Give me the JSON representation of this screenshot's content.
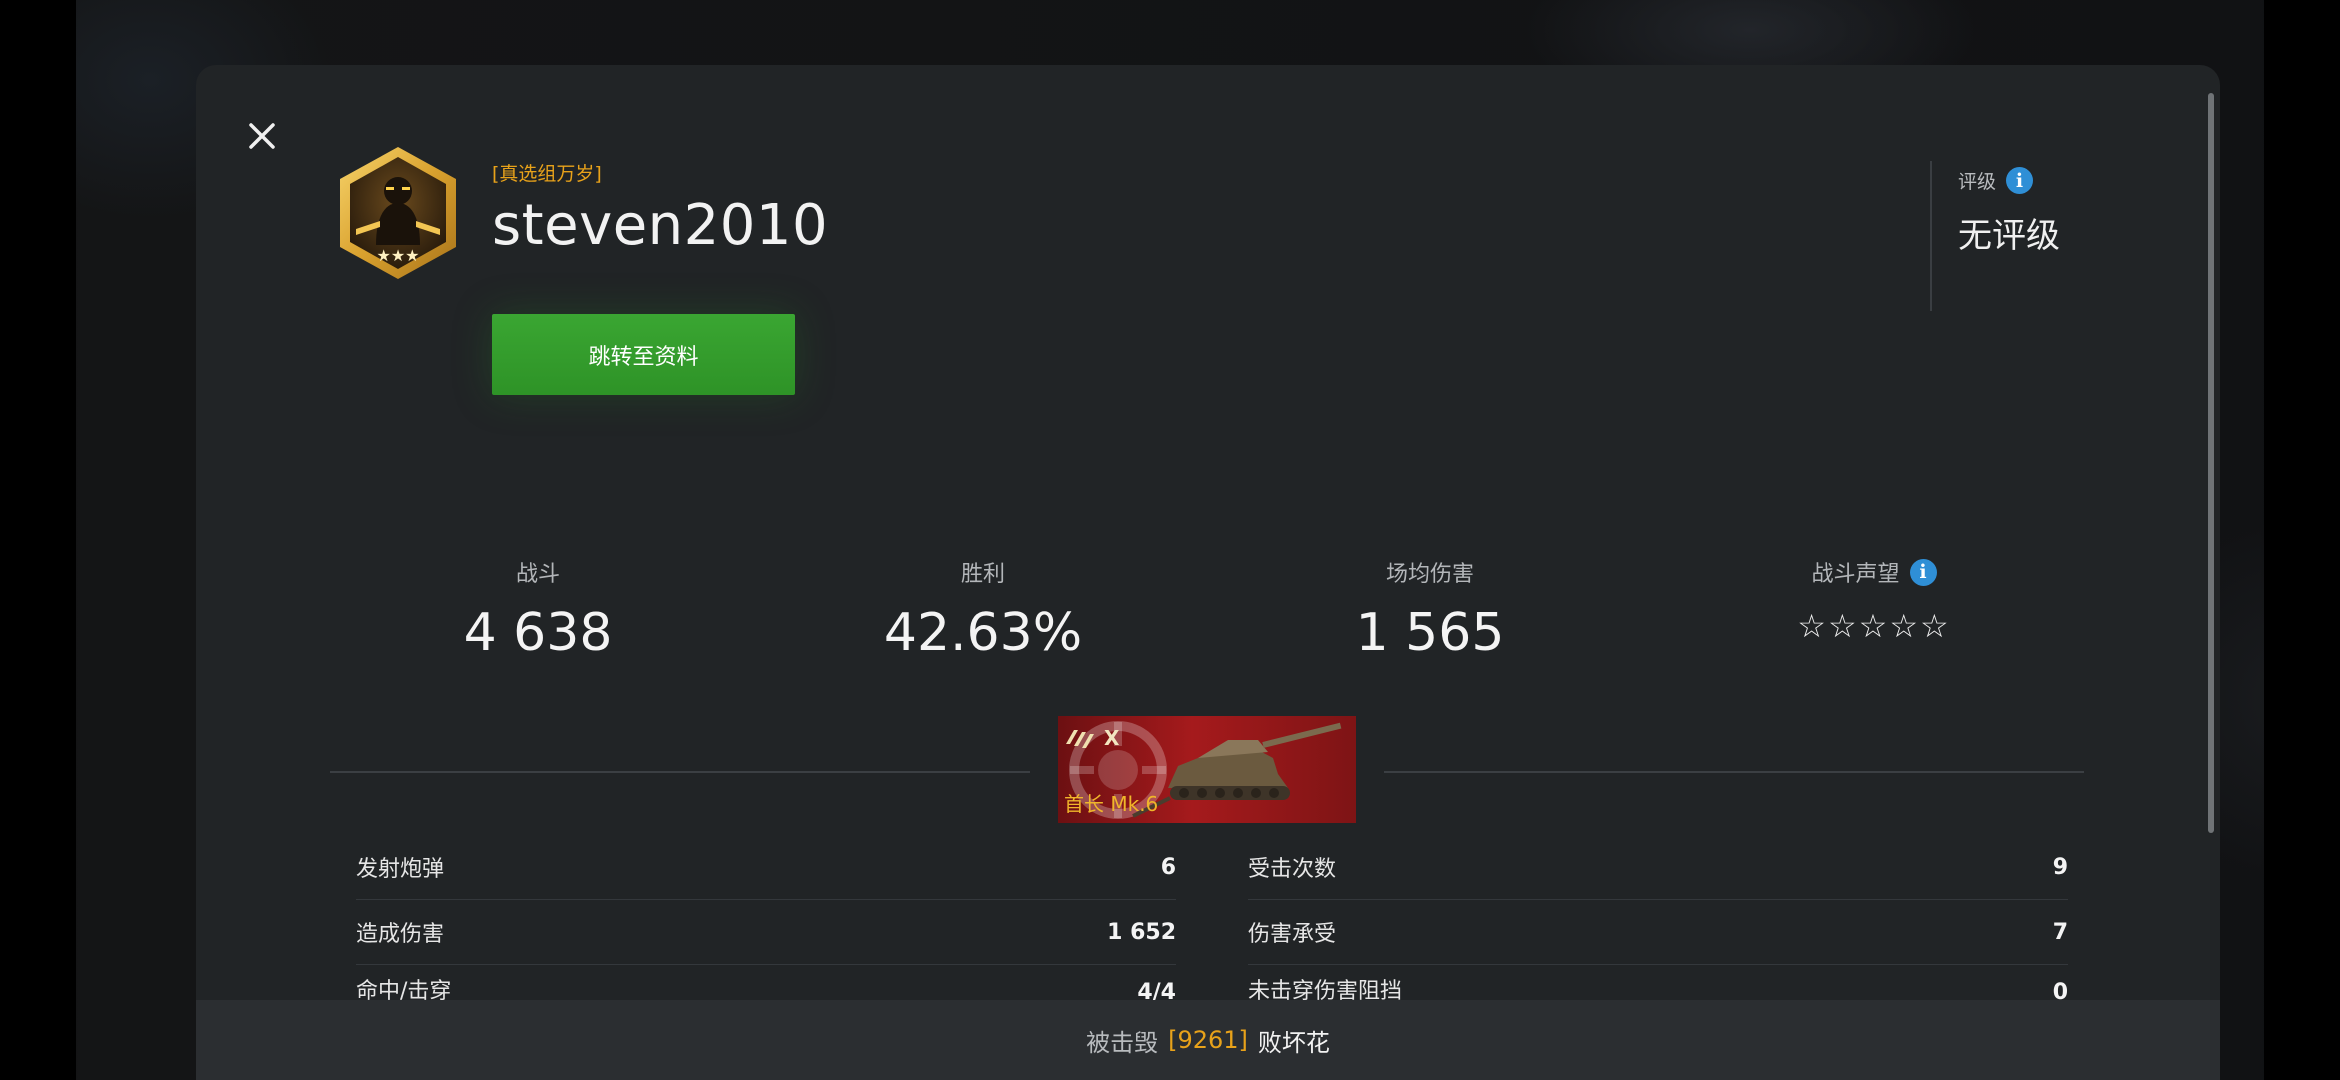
{
  "player": {
    "clan_tag": "[真选组万岁]",
    "name": "steven2010",
    "goto_profile_label": "跳转至资料"
  },
  "rating": {
    "label": "评级",
    "value": "无评级"
  },
  "stats": [
    {
      "label": "战斗",
      "value": "4 638"
    },
    {
      "label": "胜利",
      "value": "42.63%"
    },
    {
      "label": "场均伤害",
      "value": "1 565"
    },
    {
      "label": "战斗声望",
      "value": "☆☆☆☆☆",
      "stars_filled": 0,
      "stars_total": 5
    }
  ],
  "tank": {
    "name": "首长 Mk.6",
    "tier": "X"
  },
  "details_left": [
    {
      "label": "发射炮弹",
      "value": "6"
    },
    {
      "label": "造成伤害",
      "value": "1 652"
    },
    {
      "label": "命中/击穿",
      "value": "4/4"
    }
  ],
  "details_right": [
    {
      "label": "受击次数",
      "value": "9"
    },
    {
      "label": "伤害承受",
      "value": "7"
    },
    {
      "label": "未击穿伤害阻挡",
      "value": "0"
    }
  ],
  "footer": {
    "prefix": "被击毁",
    "number": "[9261]",
    "killer": "败坏花"
  },
  "colors": {
    "accent_orange": "#e8a21a",
    "button_green": "#33a02c",
    "info_blue": "#2f8fd6",
    "dialog_bg": "#212426"
  }
}
